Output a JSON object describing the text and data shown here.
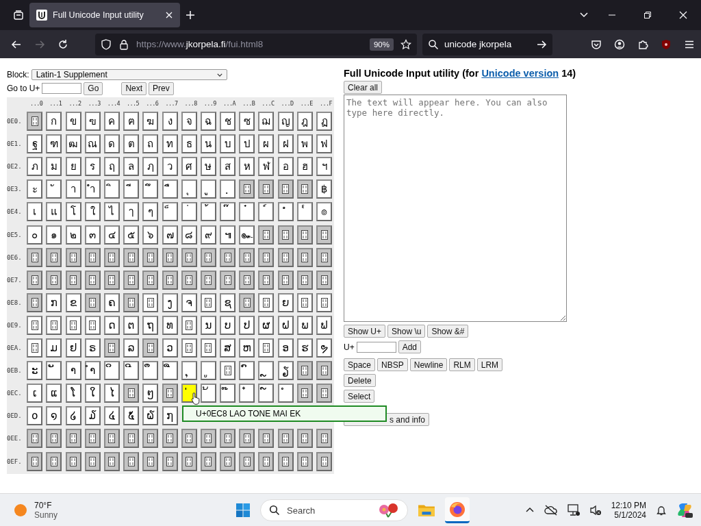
{
  "browser": {
    "tab": {
      "title": "Full Unicode Input utility",
      "selected": true
    },
    "address": {
      "prefix": "https://www.",
      "domain": "jkorpela.fi",
      "path": "/fui.html8"
    },
    "zoom": "90%",
    "search": "unicode jkorpela"
  },
  "page": {
    "block_label": "Block:",
    "block_value": "Latin-1 Supplement",
    "goto_label": "Go to U+",
    "go": "Go",
    "next": "Next",
    "prev": "Prev",
    "grid": {
      "columns": [
        "...0",
        "...1",
        "...2",
        "...3",
        "...4",
        "...5",
        "...6",
        "...7",
        "...8",
        "...9",
        "...A",
        "...B",
        "...C",
        "...D",
        "...E",
        "...F"
      ],
      "rows": [
        {
          "label": "0E0.",
          "cells": [
            {
              "kind": "unassigned",
              "selected": false
            },
            {
              "kind": "char",
              "text": "ก",
              "selected": false
            },
            {
              "kind": "char",
              "text": "ข",
              "selected": false
            },
            {
              "kind": "char",
              "text": "ฃ",
              "selected": false
            },
            {
              "kind": "char",
              "text": "ค",
              "selected": false
            },
            {
              "kind": "char",
              "text": "ฅ",
              "selected": false
            },
            {
              "kind": "char",
              "text": "ฆ",
              "selected": false
            },
            {
              "kind": "char",
              "text": "ง",
              "selected": false
            },
            {
              "kind": "char",
              "text": "จ",
              "selected": false
            },
            {
              "kind": "char",
              "text": "ฉ",
              "selected": false
            },
            {
              "kind": "char",
              "text": "ช",
              "selected": false
            },
            {
              "kind": "char",
              "text": "ซ",
              "selected": false
            },
            {
              "kind": "char",
              "text": "ฌ",
              "selected": false
            },
            {
              "kind": "char",
              "text": "ญ",
              "selected": false
            },
            {
              "kind": "char",
              "text": "ฎ",
              "selected": false
            },
            {
              "kind": "char",
              "text": "ฏ",
              "selected": false
            }
          ]
        },
        {
          "label": "0E1.",
          "cells": [
            {
              "kind": "char",
              "text": "ฐ",
              "selected": false
            },
            {
              "kind": "char",
              "text": "ฑ",
              "selected": false
            },
            {
              "kind": "char",
              "text": "ฒ",
              "selected": false
            },
            {
              "kind": "char",
              "text": "ณ",
              "selected": false
            },
            {
              "kind": "char",
              "text": "ด",
              "selected": false
            },
            {
              "kind": "char",
              "text": "ต",
              "selected": false
            },
            {
              "kind": "char",
              "text": "ถ",
              "selected": false
            },
            {
              "kind": "char",
              "text": "ท",
              "selected": false
            },
            {
              "kind": "char",
              "text": "ธ",
              "selected": false
            },
            {
              "kind": "char",
              "text": "น",
              "selected": false
            },
            {
              "kind": "char",
              "text": "บ",
              "selected": false
            },
            {
              "kind": "char",
              "text": "ป",
              "selected": false
            },
            {
              "kind": "char",
              "text": "ผ",
              "selected": false
            },
            {
              "kind": "char",
              "text": "ฝ",
              "selected": false
            },
            {
              "kind": "char",
              "text": "พ",
              "selected": false
            },
            {
              "kind": "char",
              "text": "ฟ",
              "selected": false
            }
          ]
        },
        {
          "label": "0E2.",
          "cells": [
            {
              "kind": "char",
              "text": "ภ",
              "selected": false
            },
            {
              "kind": "char",
              "text": "ม",
              "selected": false
            },
            {
              "kind": "char",
              "text": "ย",
              "selected": false
            },
            {
              "kind": "char",
              "text": "ร",
              "selected": false
            },
            {
              "kind": "char",
              "text": "ฤ",
              "selected": false
            },
            {
              "kind": "char",
              "text": "ล",
              "selected": false
            },
            {
              "kind": "char",
              "text": "ฦ",
              "selected": false
            },
            {
              "kind": "char",
              "text": "ว",
              "selected": false
            },
            {
              "kind": "char",
              "text": "ศ",
              "selected": false
            },
            {
              "kind": "char",
              "text": "ษ",
              "selected": false
            },
            {
              "kind": "char",
              "text": "ส",
              "selected": false
            },
            {
              "kind": "char",
              "text": "ห",
              "selected": false
            },
            {
              "kind": "char",
              "text": "ฬ",
              "selected": false
            },
            {
              "kind": "char",
              "text": "อ",
              "selected": false
            },
            {
              "kind": "char",
              "text": "ฮ",
              "selected": false
            },
            {
              "kind": "char",
              "text": "ฯ",
              "selected": false
            }
          ]
        },
        {
          "label": "0E3.",
          "cells": [
            {
              "kind": "char",
              "text": "ะ",
              "selected": false
            },
            {
              "kind": "char",
              "text": "ั",
              "selected": false
            },
            {
              "kind": "char",
              "text": "า",
              "selected": false
            },
            {
              "kind": "char",
              "text": "ำ",
              "selected": false
            },
            {
              "kind": "char",
              "text": "ิ",
              "selected": false
            },
            {
              "kind": "char",
              "text": "ี",
              "selected": false
            },
            {
              "kind": "char",
              "text": "ึ",
              "selected": false
            },
            {
              "kind": "char",
              "text": "ื",
              "selected": false
            },
            {
              "kind": "char",
              "text": "ุ",
              "selected": false
            },
            {
              "kind": "char",
              "text": "ู",
              "selected": false
            },
            {
              "kind": "char",
              "text": "ฺ",
              "selected": false
            },
            {
              "kind": "unassigned",
              "selected": false
            },
            {
              "kind": "unassigned",
              "selected": false
            },
            {
              "kind": "unassigned",
              "selected": false
            },
            {
              "kind": "unassigned",
              "selected": false
            },
            {
              "kind": "char",
              "text": "฿",
              "selected": false
            }
          ]
        },
        {
          "label": "0E4.",
          "cells": [
            {
              "kind": "char",
              "text": "เ",
              "selected": false
            },
            {
              "kind": "char",
              "text": "แ",
              "selected": false
            },
            {
              "kind": "char",
              "text": "โ",
              "selected": false
            },
            {
              "kind": "char",
              "text": "ใ",
              "selected": false
            },
            {
              "kind": "char",
              "text": "ไ",
              "selected": false
            },
            {
              "kind": "char",
              "text": "ๅ",
              "selected": false
            },
            {
              "kind": "char",
              "text": "ๆ",
              "selected": false
            },
            {
              "kind": "char",
              "text": "็",
              "selected": false
            },
            {
              "kind": "char",
              "text": "่",
              "selected": false
            },
            {
              "kind": "char",
              "text": "้",
              "selected": false
            },
            {
              "kind": "char",
              "text": "๊",
              "selected": false
            },
            {
              "kind": "char",
              "text": "๋",
              "selected": false
            },
            {
              "kind": "char",
              "text": "์",
              "selected": false
            },
            {
              "kind": "char",
              "text": "ํ",
              "selected": false
            },
            {
              "kind": "char",
              "text": "๎",
              "selected": false
            },
            {
              "kind": "char",
              "text": "๏",
              "selected": false
            }
          ]
        },
        {
          "label": "0E5.",
          "cells": [
            {
              "kind": "char",
              "text": "๐",
              "selected": false
            },
            {
              "kind": "char",
              "text": "๑",
              "selected": false
            },
            {
              "kind": "char",
              "text": "๒",
              "selected": false
            },
            {
              "kind": "char",
              "text": "๓",
              "selected": false
            },
            {
              "kind": "char",
              "text": "๔",
              "selected": false
            },
            {
              "kind": "char",
              "text": "๕",
              "selected": false
            },
            {
              "kind": "char",
              "text": "๖",
              "selected": false
            },
            {
              "kind": "char",
              "text": "๗",
              "selected": false
            },
            {
              "kind": "char",
              "text": "๘",
              "selected": false
            },
            {
              "kind": "char",
              "text": "๙",
              "selected": false
            },
            {
              "kind": "char",
              "text": "๚",
              "selected": false
            },
            {
              "kind": "char",
              "text": "๛",
              "selected": false
            },
            {
              "kind": "unassigned",
              "selected": false
            },
            {
              "kind": "unassigned",
              "selected": false
            },
            {
              "kind": "unassigned",
              "selected": false
            },
            {
              "kind": "unassigned",
              "selected": false
            }
          ]
        },
        {
          "label": "0E6.",
          "cells": [
            {
              "kind": "unassigned",
              "selected": false
            },
            {
              "kind": "unassigned",
              "selected": false
            },
            {
              "kind": "unassigned",
              "selected": false
            },
            {
              "kind": "unassigned",
              "selected": false
            },
            {
              "kind": "unassigned",
              "selected": false
            },
            {
              "kind": "unassigned",
              "selected": false
            },
            {
              "kind": "unassigned",
              "selected": false
            },
            {
              "kind": "unassigned",
              "selected": false
            },
            {
              "kind": "unassigned",
              "selected": false
            },
            {
              "kind": "unassigned",
              "selected": false
            },
            {
              "kind": "unassigned",
              "selected": false
            },
            {
              "kind": "unassigned",
              "selected": false
            },
            {
              "kind": "unassigned",
              "selected": false
            },
            {
              "kind": "unassigned",
              "selected": false
            },
            {
              "kind": "unassigned",
              "selected": false
            },
            {
              "kind": "unassigned",
              "selected": false
            }
          ]
        },
        {
          "label": "0E7.",
          "cells": [
            {
              "kind": "unassigned",
              "selected": false
            },
            {
              "kind": "unassigned",
              "selected": false
            },
            {
              "kind": "unassigned",
              "selected": false
            },
            {
              "kind": "unassigned",
              "selected": false
            },
            {
              "kind": "unassigned",
              "selected": false
            },
            {
              "kind": "unassigned",
              "selected": false
            },
            {
              "kind": "unassigned",
              "selected": false
            },
            {
              "kind": "unassigned",
              "selected": false
            },
            {
              "kind": "unassigned",
              "selected": false
            },
            {
              "kind": "unassigned",
              "selected": false
            },
            {
              "kind": "unassigned",
              "selected": false
            },
            {
              "kind": "unassigned",
              "selected": false
            },
            {
              "kind": "unassigned",
              "selected": false
            },
            {
              "kind": "unassigned",
              "selected": false
            },
            {
              "kind": "unassigned",
              "selected": false
            },
            {
              "kind": "unassigned",
              "selected": false
            }
          ]
        },
        {
          "label": "0E8.",
          "cells": [
            {
              "kind": "unassigned",
              "selected": false
            },
            {
              "kind": "char",
              "text": "ກ",
              "selected": false
            },
            {
              "kind": "char",
              "text": "ຂ",
              "selected": false
            },
            {
              "kind": "unassigned",
              "selected": false
            },
            {
              "kind": "char",
              "text": "ຄ",
              "selected": false
            },
            {
              "kind": "unassigned",
              "selected": false
            },
            {
              "kind": "nofont",
              "selected": false
            },
            {
              "kind": "char",
              "text": "ງ",
              "selected": false
            },
            {
              "kind": "char",
              "text": "ຈ",
              "selected": false
            },
            {
              "kind": "nofont",
              "selected": false
            },
            {
              "kind": "char",
              "text": "ຊ",
              "selected": false
            },
            {
              "kind": "unassigned",
              "selected": false
            },
            {
              "kind": "nofont",
              "selected": false
            },
            {
              "kind": "char",
              "text": "ຍ",
              "selected": false
            },
            {
              "kind": "nofont",
              "selected": false
            },
            {
              "kind": "nofont",
              "selected": false
            }
          ]
        },
        {
          "label": "0E9.",
          "cells": [
            {
              "kind": "nofont",
              "selected": false
            },
            {
              "kind": "nofont",
              "selected": false
            },
            {
              "kind": "nofont",
              "selected": false
            },
            {
              "kind": "nofont",
              "selected": false
            },
            {
              "kind": "char",
              "text": "ດ",
              "selected": false
            },
            {
              "kind": "char",
              "text": "ຕ",
              "selected": false
            },
            {
              "kind": "char",
              "text": "ຖ",
              "selected": false
            },
            {
              "kind": "char",
              "text": "ທ",
              "selected": false
            },
            {
              "kind": "nofont",
              "selected": false
            },
            {
              "kind": "char",
              "text": "ນ",
              "selected": false
            },
            {
              "kind": "char",
              "text": "ບ",
              "selected": false
            },
            {
              "kind": "char",
              "text": "ປ",
              "selected": false
            },
            {
              "kind": "char",
              "text": "ຜ",
              "selected": false
            },
            {
              "kind": "char",
              "text": "ຝ",
              "selected": false
            },
            {
              "kind": "char",
              "text": "ພ",
              "selected": false
            },
            {
              "kind": "char",
              "text": "ຟ",
              "selected": false
            }
          ]
        },
        {
          "label": "0EA.",
          "cells": [
            {
              "kind": "nofont",
              "selected": false
            },
            {
              "kind": "char",
              "text": "ມ",
              "selected": false
            },
            {
              "kind": "char",
              "text": "ຢ",
              "selected": false
            },
            {
              "kind": "char",
              "text": "ຣ",
              "selected": false
            },
            {
              "kind": "unassigned",
              "selected": false
            },
            {
              "kind": "char",
              "text": "ລ",
              "selected": false
            },
            {
              "kind": "unassigned",
              "selected": false
            },
            {
              "kind": "char",
              "text": "ວ",
              "selected": false
            },
            {
              "kind": "nofont",
              "selected": false
            },
            {
              "kind": "nofont",
              "selected": false
            },
            {
              "kind": "char",
              "text": "ສ",
              "selected": false
            },
            {
              "kind": "char",
              "text": "ຫ",
              "selected": false
            },
            {
              "kind": "nofont",
              "selected": false
            },
            {
              "kind": "char",
              "text": "ອ",
              "selected": false
            },
            {
              "kind": "char",
              "text": "ຮ",
              "selected": false
            },
            {
              "kind": "char",
              "text": "ຯ",
              "selected": false
            }
          ]
        },
        {
          "label": "0EB.",
          "cells": [
            {
              "kind": "char",
              "text": "ະ",
              "selected": false
            },
            {
              "kind": "char",
              "text": "ັ",
              "selected": false
            },
            {
              "kind": "char",
              "text": "າ",
              "selected": false
            },
            {
              "kind": "char",
              "text": "ຳ",
              "selected": false
            },
            {
              "kind": "char",
              "text": "ິ",
              "selected": false
            },
            {
              "kind": "char",
              "text": "ີ",
              "selected": false
            },
            {
              "kind": "char",
              "text": "ຶ",
              "selected": false
            },
            {
              "kind": "char",
              "text": "ື",
              "selected": false
            },
            {
              "kind": "char",
              "text": "ຸ",
              "selected": false
            },
            {
              "kind": "char",
              "text": "ູ",
              "selected": false
            },
            {
              "kind": "nofont",
              "selected": false
            },
            {
              "kind": "char",
              "text": "ົ",
              "selected": false
            },
            {
              "kind": "char",
              "text": "ຼ",
              "selected": false
            },
            {
              "kind": "char",
              "text": "ຽ",
              "selected": false
            },
            {
              "kind": "unassigned",
              "selected": false
            },
            {
              "kind": "unassigned",
              "selected": false
            }
          ]
        },
        {
          "label": "0EC.",
          "cells": [
            {
              "kind": "char",
              "text": "ເ",
              "selected": false
            },
            {
              "kind": "char",
              "text": "ແ",
              "selected": false
            },
            {
              "kind": "char",
              "text": "ໂ",
              "selected": false
            },
            {
              "kind": "char",
              "text": "ໃ",
              "selected": false
            },
            {
              "kind": "char",
              "text": "ໄ",
              "selected": false
            },
            {
              "kind": "unassigned",
              "selected": false
            },
            {
              "kind": "char",
              "text": "ໆ",
              "selected": false
            },
            {
              "kind": "unassigned",
              "selected": false
            },
            {
              "kind": "char",
              "text": "່",
              "selected": true
            },
            {
              "kind": "char",
              "text": "້",
              "selected": false
            },
            {
              "kind": "char",
              "text": "໊",
              "selected": false
            },
            {
              "kind": "char",
              "text": "໋",
              "selected": false
            },
            {
              "kind": "char",
              "text": "໌",
              "selected": false
            },
            {
              "kind": "char",
              "text": "ໍ",
              "selected": false
            },
            {
              "kind": "unassigned",
              "selected": false
            },
            {
              "kind": "unassigned",
              "selected": false
            }
          ]
        },
        {
          "label": "0ED.",
          "cells": [
            {
              "kind": "char",
              "text": "໐",
              "selected": false
            },
            {
              "kind": "char",
              "text": "໑",
              "selected": false
            },
            {
              "kind": "char",
              "text": "໒",
              "selected": false
            },
            {
              "kind": "char",
              "text": "໓",
              "selected": false
            },
            {
              "kind": "char",
              "text": "໔",
              "selected": false
            },
            {
              "kind": "char",
              "text": "໕",
              "selected": false
            },
            {
              "kind": "char",
              "text": "໖",
              "selected": false
            },
            {
              "kind": "char",
              "text": "໗",
              "selected": false
            }
          ]
        },
        {
          "label": "0EE.",
          "cells": [
            {
              "kind": "unassigned",
              "selected": false
            },
            {
              "kind": "unassigned",
              "selected": false
            },
            {
              "kind": "unassigned",
              "selected": false
            },
            {
              "kind": "unassigned",
              "selected": false
            },
            {
              "kind": "unassigned",
              "selected": false
            },
            {
              "kind": "unassigned",
              "selected": false
            },
            {
              "kind": "unassigned",
              "selected": false
            },
            {
              "kind": "unassigned",
              "selected": false
            },
            {
              "kind": "unassigned",
              "selected": false
            },
            {
              "kind": "unassigned",
              "selected": false
            },
            {
              "kind": "unassigned",
              "selected": false
            },
            {
              "kind": "unassigned",
              "selected": false
            },
            {
              "kind": "unassigned",
              "selected": false
            },
            {
              "kind": "unassigned",
              "selected": false
            },
            {
              "kind": "unassigned",
              "selected": false
            },
            {
              "kind": "unassigned",
              "selected": false
            }
          ]
        },
        {
          "label": "0EF.",
          "cells": [
            {
              "kind": "unassigned",
              "selected": false
            },
            {
              "kind": "unassigned",
              "selected": false
            },
            {
              "kind": "unassigned",
              "selected": false
            },
            {
              "kind": "unassigned",
              "selected": false
            },
            {
              "kind": "unassigned",
              "selected": false
            },
            {
              "kind": "unassigned",
              "selected": false
            },
            {
              "kind": "unassigned",
              "selected": false
            },
            {
              "kind": "unassigned",
              "selected": false
            },
            {
              "kind": "unassigned",
              "selected": false
            },
            {
              "kind": "unassigned",
              "selected": false
            },
            {
              "kind": "unassigned",
              "selected": false
            },
            {
              "kind": "unassigned",
              "selected": false
            },
            {
              "kind": "unassigned",
              "selected": false
            },
            {
              "kind": "unassigned",
              "selected": false
            },
            {
              "kind": "unassigned",
              "selected": false
            },
            {
              "kind": "unassigned",
              "selected": false
            }
          ]
        }
      ]
    },
    "tooltip": "U+0EC8 LAO TONE MAI EK",
    "title_before": "Full Unicode Input utility (for ",
    "title_link": "Unicode version",
    "title_after": " 14)",
    "clear": "Clear all",
    "text_placeholder": "The text will appear here. You can also type here directly.",
    "show_buttons": [
      "Show U+",
      "Show \\u",
      "Show &#"
    ],
    "add_label": "U+",
    "add": "Add",
    "insert_buttons": [
      "Space",
      "NBSP",
      "Newline",
      "RLM",
      "LRM"
    ],
    "delete": "Delete",
    "select": "Select",
    "info": "s and info"
  },
  "taskbar": {
    "temperature": "70°F",
    "weather": "Sunny",
    "search": "Search",
    "time": "12:10 PM",
    "date": "5/1/2024"
  }
}
